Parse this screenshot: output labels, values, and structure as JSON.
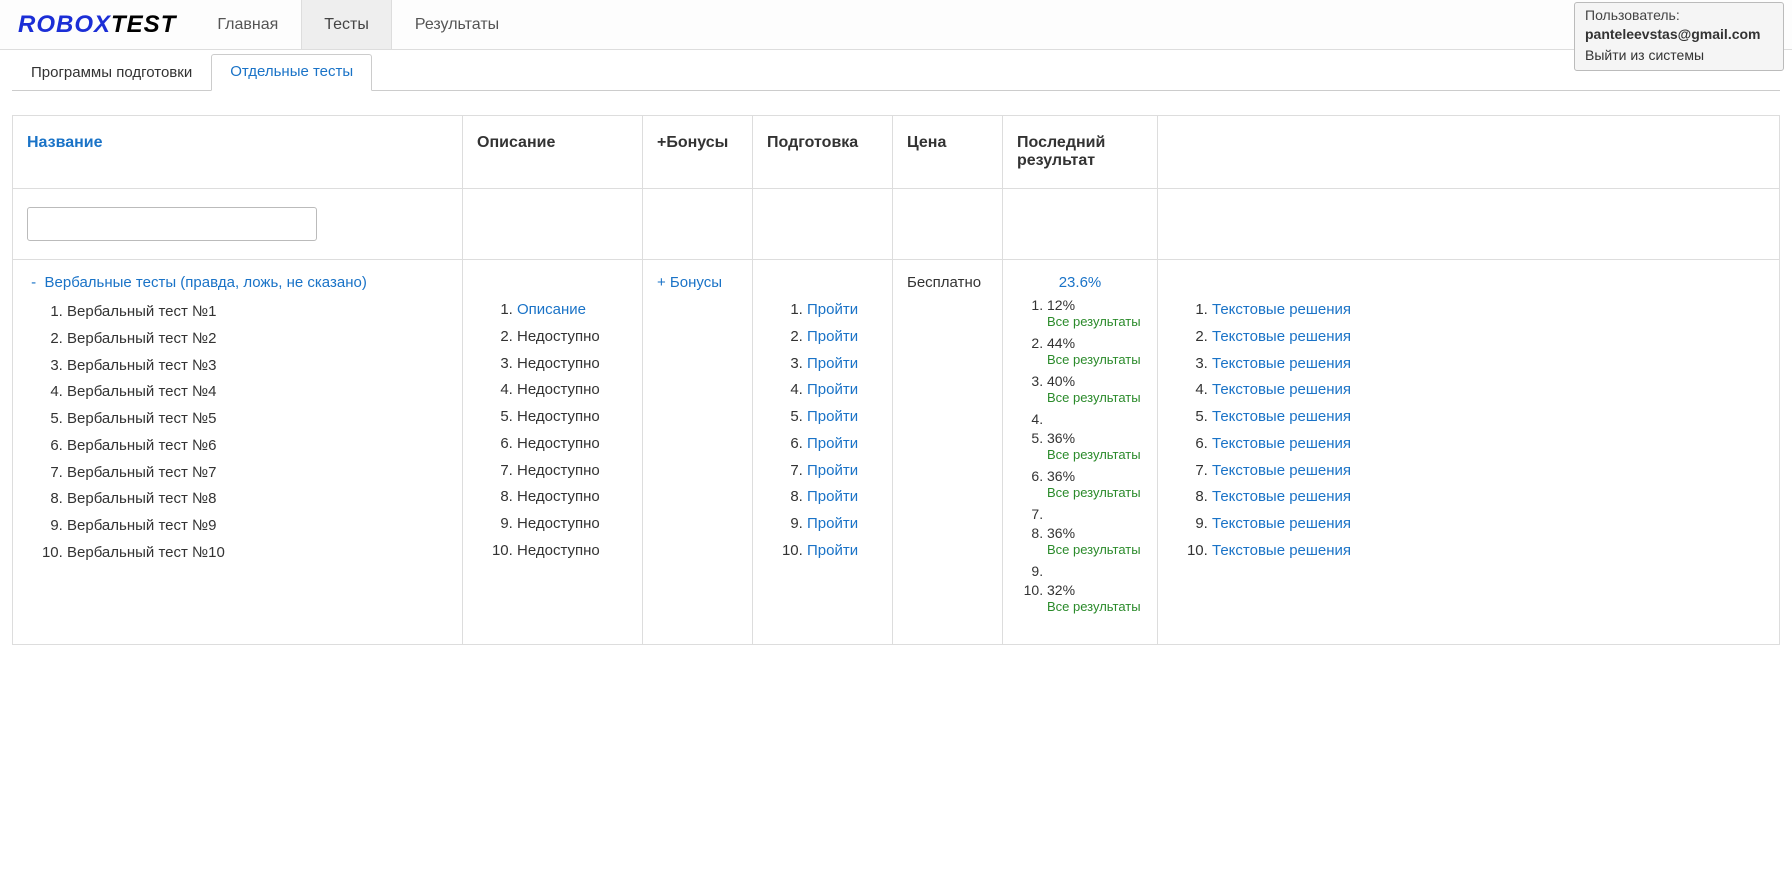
{
  "logo": {
    "part1": "ROBOX",
    "part2": "TEST"
  },
  "topnav": [
    {
      "key": "home",
      "label": "Главная",
      "active": false
    },
    {
      "key": "tests",
      "label": "Тесты",
      "active": true
    },
    {
      "key": "results",
      "label": "Результаты",
      "active": false
    }
  ],
  "userbox": {
    "label": "Пользователь:",
    "email": "panteleevstas@gmail.com",
    "logout": "Выйти из системы"
  },
  "subtabs": [
    {
      "key": "programs",
      "label": "Программы подготовки",
      "active": false
    },
    {
      "key": "single",
      "label": "Отдельные тесты",
      "active": true
    }
  ],
  "columns": {
    "name": "Название",
    "desc": "Описание",
    "bonus": "+Бонусы",
    "prep": "Подготовка",
    "price": "Цена",
    "result": "Последний результат"
  },
  "filter": {
    "value": ""
  },
  "row": {
    "collapse_prefix": "-",
    "group_title": "Вербальные тесты (правда, ложь, не сказано)",
    "tests": [
      "Вербальный тест №1",
      "Вербальный тест №2",
      "Вербальный тест №3",
      "Вербальный тест №4",
      "Вербальный тест №5",
      "Вербальный тест №6",
      "Вербальный тест №7",
      "Вербальный тест №8",
      "Вербальный тест №9",
      "Вербальный тест №10"
    ],
    "descriptions": [
      {
        "text": "Описание",
        "link": true
      },
      {
        "text": "Недоступно",
        "link": false
      },
      {
        "text": "Недоступно",
        "link": false
      },
      {
        "text": "Недоступно",
        "link": false
      },
      {
        "text": "Недоступно",
        "link": false
      },
      {
        "text": "Недоступно",
        "link": false
      },
      {
        "text": "Недоступно",
        "link": false
      },
      {
        "text": "Недоступно",
        "link": false
      },
      {
        "text": "Недоступно",
        "link": false
      },
      {
        "text": "Недоступно",
        "link": false
      }
    ],
    "bonus_link": "+ Бонусы",
    "prep_label": "Пройти",
    "prep_count": 10,
    "price": "Бесплатно",
    "result_top": "23.6%",
    "all_results_label": "Все результаты",
    "results": [
      {
        "value": "12%",
        "has_link": true
      },
      {
        "value": "44%",
        "has_link": true
      },
      {
        "value": "40%",
        "has_link": true
      },
      {
        "value": "",
        "has_link": false
      },
      {
        "value": "36%",
        "has_link": true
      },
      {
        "value": "36%",
        "has_link": true
      },
      {
        "value": "",
        "has_link": false
      },
      {
        "value": "36%",
        "has_link": true
      },
      {
        "value": "",
        "has_link": false
      },
      {
        "value": "32%",
        "has_link": true
      }
    ],
    "solution_label": "Текстовые решения",
    "solution_count": 10
  }
}
